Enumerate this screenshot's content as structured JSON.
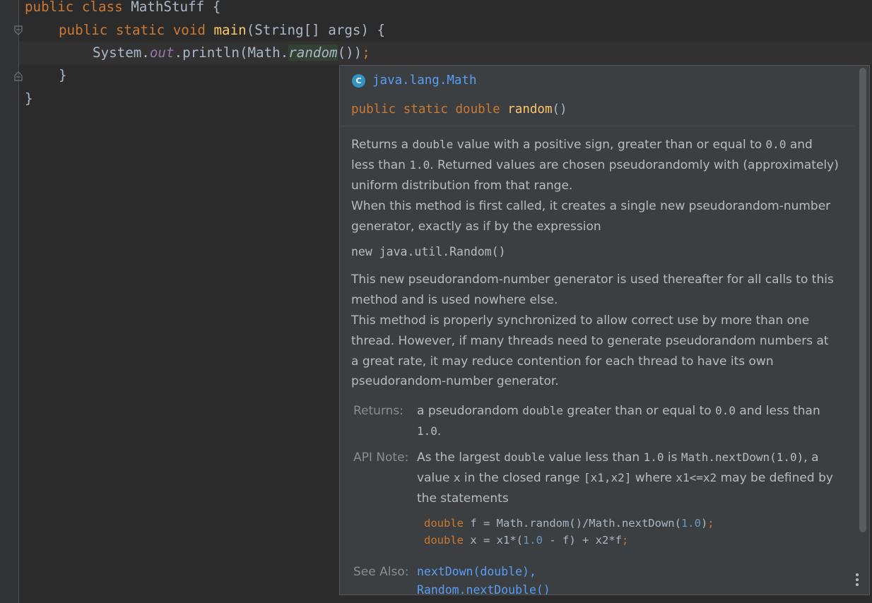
{
  "editor": {
    "line1": {
      "kw": "public class ",
      "name": "MathStuff {"
    },
    "line2": {
      "kw": "public static void ",
      "fn": "main",
      "rest": "(String[] args) {"
    },
    "line3": {
      "a": "System.",
      "field": "out",
      "b": ".println(Math.",
      "method": "random",
      "c": "())",
      "semi": ";"
    },
    "line4": "}",
    "line5": "}"
  },
  "popup": {
    "class_icon": "C",
    "package": "java.lang.Math",
    "signature": {
      "kw": "public static double ",
      "name": "random",
      "parens": "()"
    },
    "p1": {
      "t1": "Returns a ",
      "c1": "double",
      "t2": " value with a positive sign, greater than or equal to ",
      "c2": "0.0",
      "t3": " and less than ",
      "c3": "1.0",
      "t4": ". Returned values are chosen pseudorandomly with (approximately) uniform distribution from that range."
    },
    "p2": "When this method is first called, it creates a single new pseudorandom-number generator, exactly as if by the expression",
    "expr": "new java.util.Random()",
    "p3": "This new pseudorandom-number generator is used thereafter for all calls to this method and is used nowhere else.",
    "p4": "This method is properly synchronized to allow correct use by more than one thread. However, if many threads need to generate pseudorandom numbers at a great rate, it may reduce contention for each thread to have its own pseudorandom-number generator.",
    "returns": {
      "label": "Returns:",
      "t1": "a pseudorandom ",
      "c1": "double",
      "t2": " greater than or equal to ",
      "c2": "0.0",
      "t3": " and less than ",
      "c3": "1.0",
      "t4": "."
    },
    "api_note": {
      "label": "API Note:",
      "t1": "As the largest ",
      "c1": "double",
      "t2": " value less than ",
      "c2": "1.0",
      "t3": " is ",
      "c3": "Math.nextDown(1.0)",
      "t4": ", a value ",
      "c4": "x",
      "t5": " in the closed range ",
      "c5": "[x1,x2]",
      "t6": " where ",
      "c6": "x1<=x2",
      "t7": " may be defined by the statements",
      "code1": {
        "kw": "double",
        "a": " f = Math.random()/Math.nextDown(",
        "num": "1.0",
        "b": ")",
        "semi": ";"
      },
      "code2": {
        "kw": "double",
        "a": " x = x1*(",
        "num": "1.0",
        "b": " - f) + x2*f",
        "semi": ";"
      }
    },
    "see_also": {
      "label": "See Also:",
      "link1": "nextDown(double),",
      "link2": "Random.nextDouble()"
    }
  }
}
